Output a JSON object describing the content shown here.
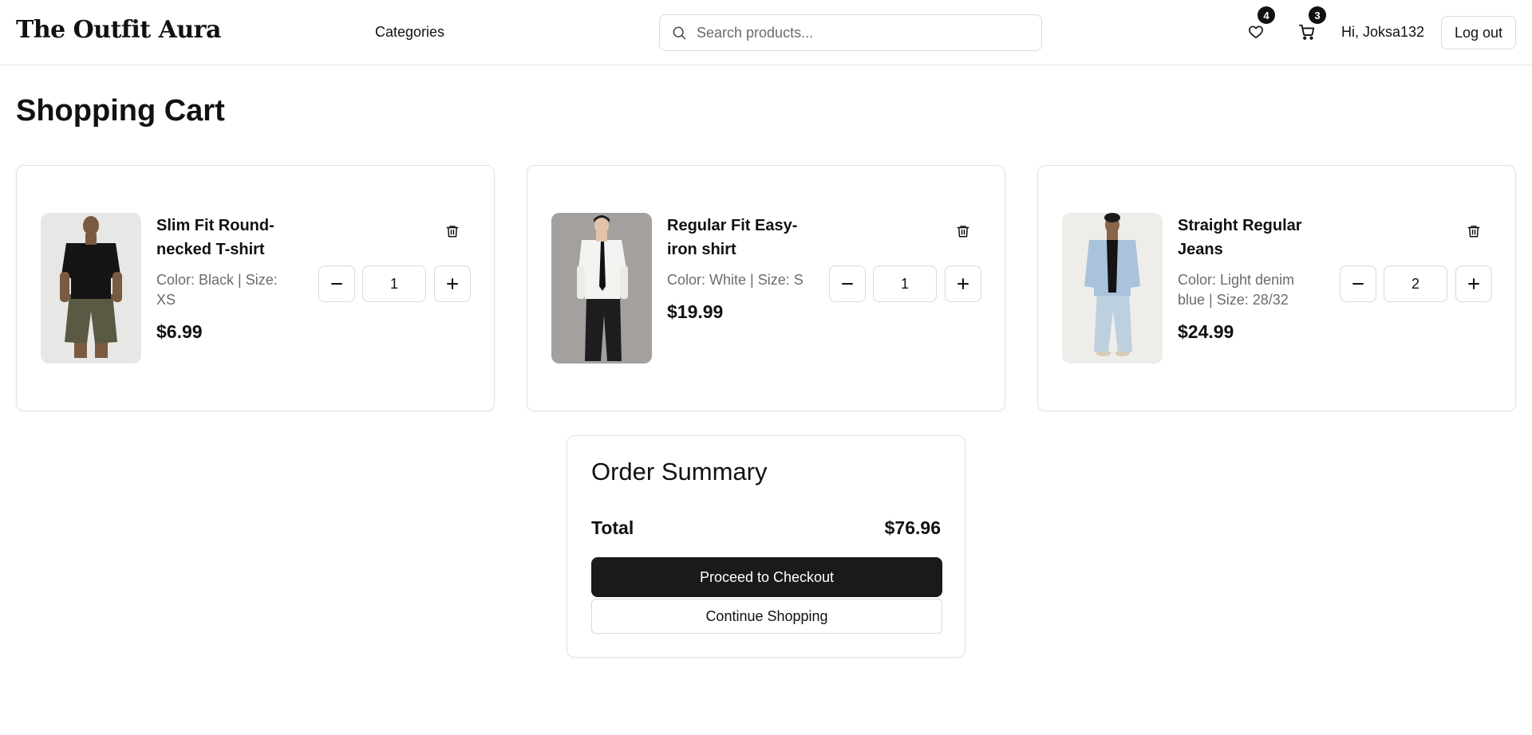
{
  "header": {
    "logo": "The Outfit Aura",
    "nav_categories": "Categories",
    "search_placeholder": "Search products...",
    "wishlist_count": "4",
    "cart_count": "3",
    "greeting": "Hi, Joksa132",
    "logout_label": "Log out",
    "icons": {
      "search": "search-icon",
      "wishlist": "heart-icon",
      "cart": "cart-icon"
    }
  },
  "page": {
    "title": "Shopping Cart"
  },
  "cart": {
    "items": [
      {
        "name": "Slim Fit Round-necked T-shirt",
        "variant": "Color: Black | Size: XS",
        "price": "$6.99",
        "quantity": "1",
        "image_icon": "product-photo-black-tshirt"
      },
      {
        "name": "Regular Fit Easy-iron shirt",
        "variant": "Color: White | Size: S",
        "price": "$19.99",
        "quantity": "1",
        "image_icon": "product-photo-white-shirt"
      },
      {
        "name": "Straight Regular Jeans",
        "variant": "Color: Light denim blue | Size: 28/32",
        "price": "$24.99",
        "quantity": "2",
        "image_icon": "product-photo-denim-jeans"
      }
    ],
    "item_icons": {
      "delete": "trash-icon",
      "decrease": "minus-icon",
      "increase": "plus-icon"
    }
  },
  "summary": {
    "title": "Order Summary",
    "total_label": "Total",
    "total_value": "$76.96",
    "checkout_label": "Proceed to Checkout",
    "continue_label": "Continue Shopping"
  },
  "colors": {
    "primary_button": "#1a1a1a",
    "muted_text": "#6b6b6b",
    "border": "#d9d9d9",
    "badge": "#111111"
  }
}
